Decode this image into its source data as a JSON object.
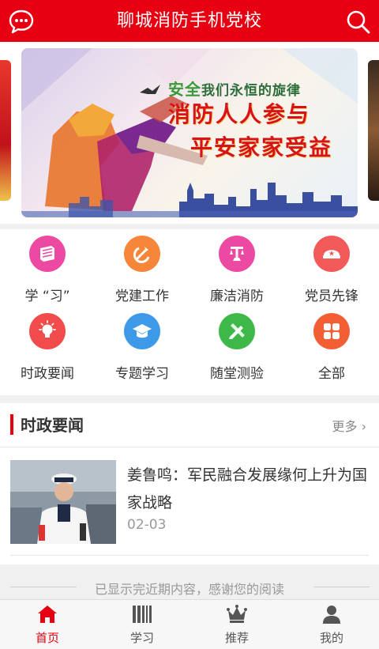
{
  "header": {
    "title": "聊城消防手机党校",
    "left_icon": "chat-bubble-icon",
    "right_icon": "search-icon"
  },
  "banner": {
    "slogan_accent": "安全",
    "slogan_line1": "我们永恒的旋律",
    "slogan_line2": "消防人人参与",
    "slogan_line3": "平安家家受益"
  },
  "grid": [
    {
      "label": "学 “习”",
      "icon": "book-icon",
      "color": "#ec4aa2"
    },
    {
      "label": "党建工作",
      "icon": "party-emblem-icon",
      "color": "#f5863a"
    },
    {
      "label": "廉洁消防",
      "icon": "scales-icon",
      "color": "#ec4aa2"
    },
    {
      "label": "党员先锋",
      "icon": "cap-icon",
      "color": "#f25a5a"
    },
    {
      "label": "时政要闻",
      "icon": "lightbulb-icon",
      "color": "#f24b4b"
    },
    {
      "label": "专题学习",
      "icon": "graduation-cap-icon",
      "color": "#3d9ae8"
    },
    {
      "label": "随堂测验",
      "icon": "pencil-ruler-icon",
      "color": "#3fb84a"
    },
    {
      "label": "全部",
      "icon": "grid-icon",
      "color": "#f25f35"
    }
  ],
  "news": {
    "section_title": "时政要闻",
    "more_label": "更多",
    "items": [
      {
        "headline": "姜鲁鸣：军民融合发展缘何上升为国家战略",
        "date": "02-03"
      }
    ]
  },
  "end_note": "已显示完近期内容，感谢您的阅读",
  "bottom_nav": [
    {
      "label": "首页",
      "icon": "home-icon",
      "active": true
    },
    {
      "label": "学习",
      "icon": "books-icon",
      "active": false
    },
    {
      "label": "推荐",
      "icon": "crown-icon",
      "active": false
    },
    {
      "label": "我的",
      "icon": "user-icon",
      "active": false
    }
  ],
  "colors": {
    "brand": "#e60012",
    "inactive": "#555555"
  }
}
